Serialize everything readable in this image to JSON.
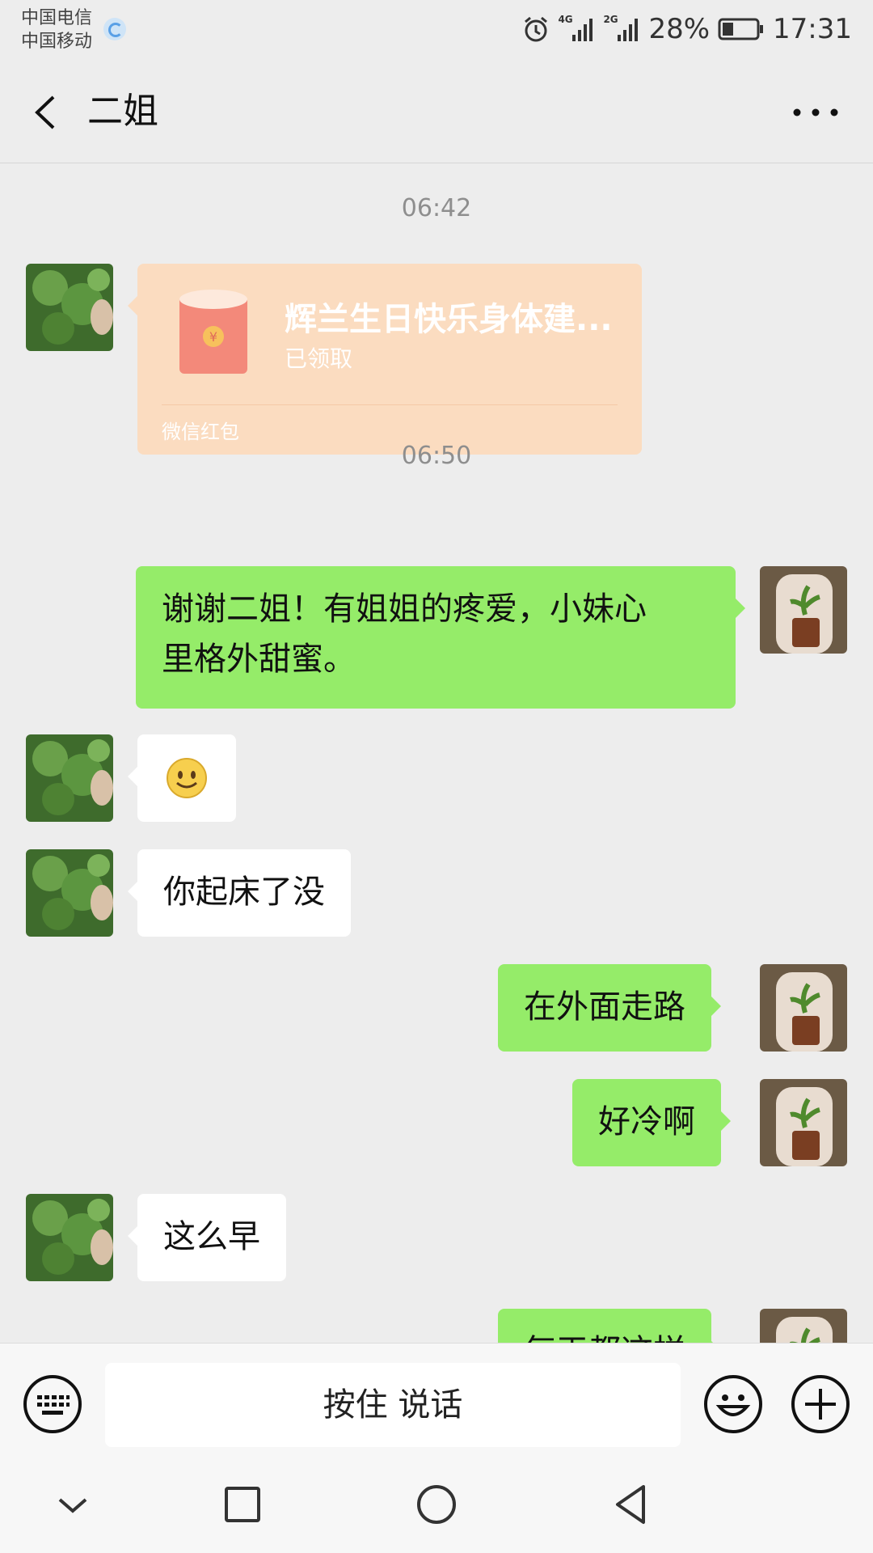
{
  "status_bar": {
    "carrier_1": "中国电信",
    "carrier_2": "中国移动",
    "net_1": "4G",
    "net_2": "2G",
    "battery": "28%",
    "time": "17:31"
  },
  "nav": {
    "title": "二姐",
    "back_icon": "chevron-left-icon",
    "more_icon": "more-dots-icon"
  },
  "messages": [
    {
      "type": "time",
      "text": "06:42"
    },
    {
      "type": "red_packet",
      "side": "left",
      "title": "辉兰生日快乐身体建...",
      "status": "已领取",
      "brand": "微信红包"
    },
    {
      "type": "time",
      "text": "06:50"
    },
    {
      "type": "text",
      "side": "right",
      "line1": "谢谢二姐！有姐姐的疼爱，小妹心",
      "line2": "里格外甜蜜。"
    },
    {
      "type": "emoji",
      "side": "left",
      "emoji": "smile"
    },
    {
      "type": "text",
      "side": "left",
      "text": "你起床了没"
    },
    {
      "type": "text",
      "side": "right",
      "text": "在外面走路"
    },
    {
      "type": "text",
      "side": "right",
      "text": "好冷啊"
    },
    {
      "type": "text",
      "side": "left",
      "text": "这么早"
    },
    {
      "type": "text",
      "side": "right",
      "text": "每天都这样"
    }
  ],
  "input": {
    "voice_label": "按住 说话",
    "keyboard_icon": "keyboard-icon",
    "emoji_icon": "emoji-icon",
    "plus_icon": "plus-circle-icon"
  },
  "colors": {
    "background": "#ededed",
    "bubble_right": "#95ec69",
    "bubble_left": "#ffffff",
    "red_packet": "#fbdcc0"
  }
}
